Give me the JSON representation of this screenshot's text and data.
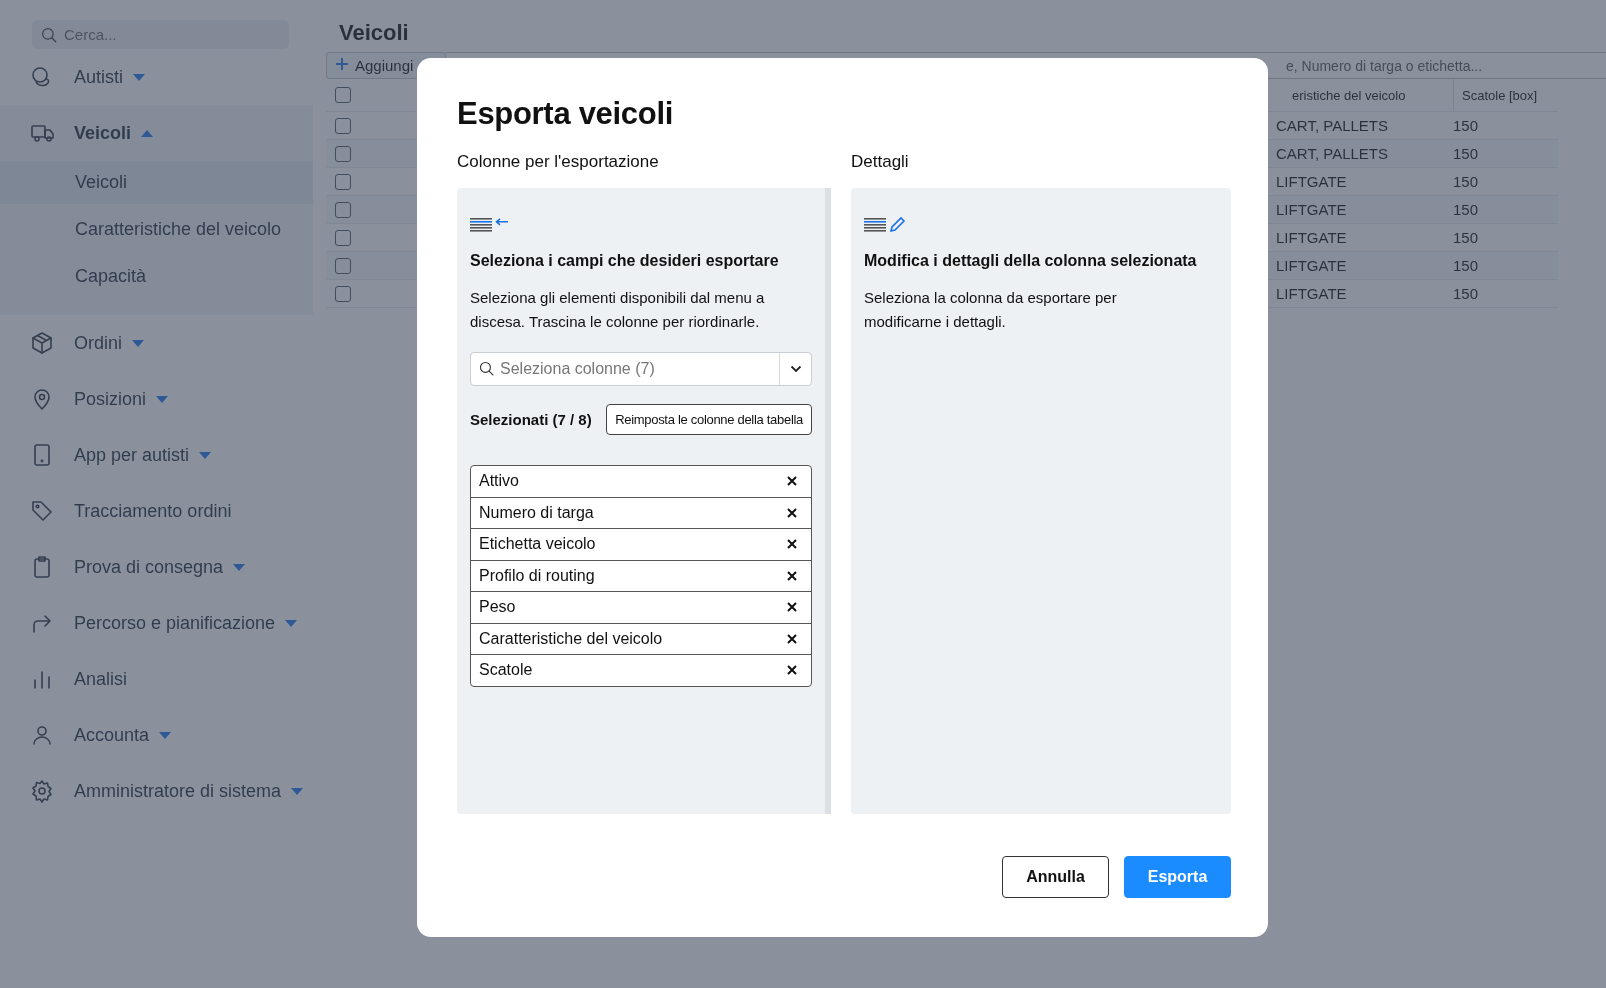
{
  "sidebar": {
    "search": {
      "placeholder": "Cerca..."
    },
    "items": [
      {
        "label": "Autisti",
        "expanded": false,
        "selected": false
      },
      {
        "label": "Veicoli",
        "expanded": true,
        "selected": true,
        "children": [
          {
            "label": "Veicoli",
            "selected": true
          },
          {
            "label": "Caratteristiche del veicolo",
            "selected": false
          },
          {
            "label": "Capacità",
            "selected": false
          }
        ]
      },
      {
        "label": "Ordini",
        "expanded": false,
        "selected": false
      },
      {
        "label": "Posizioni",
        "expanded": false,
        "selected": false
      },
      {
        "label": "App per autisti",
        "expanded": false,
        "selected": false
      },
      {
        "label": "Tracciamento ordini",
        "selected": false
      },
      {
        "label": "Prova di consegna",
        "expanded": false,
        "selected": false
      },
      {
        "label": "Percorso e pianificazione",
        "expanded": false,
        "selected": false
      },
      {
        "label": "Analisi",
        "selected": false
      },
      {
        "label": "Accounta",
        "expanded": false,
        "selected": false
      },
      {
        "label": "Amministratore di sistema",
        "expanded": false,
        "selected": false
      }
    ]
  },
  "page": {
    "title": "Veicoli",
    "add_button": "Aggiungi",
    "search": {
      "placeholder": "e, Numero di targa o etichetta..."
    },
    "table": {
      "columns": [
        "eristiche del veicolo",
        "Scatole [box]"
      ],
      "header_checked": false,
      "rows": [
        {
          "checked": false,
          "cells": [
            "CART, PALLETS",
            "150"
          ]
        },
        {
          "checked": false,
          "cells": [
            "CART, PALLETS",
            "150"
          ]
        },
        {
          "checked": false,
          "cells": [
            "LIFTGATE",
            "150"
          ]
        },
        {
          "checked": false,
          "cells": [
            "LIFTGATE",
            "150"
          ]
        },
        {
          "checked": false,
          "cells": [
            "LIFTGATE",
            "150"
          ]
        },
        {
          "checked": false,
          "cells": [
            "LIFTGATE",
            "150"
          ]
        },
        {
          "checked": false,
          "cells": [
            "LIFTGATE",
            "150"
          ]
        }
      ]
    }
  },
  "dialog": {
    "title": "Esporta veicoli",
    "left": {
      "label": "Colonne per l'esportazione",
      "heading": "Seleziona i campi che desideri esportare",
      "text": "Seleziona gli elementi disponibili dal menu a discesa. Trascina le colonne per riordinarle.",
      "select": {
        "placeholder": "Seleziona colonne (7)"
      },
      "selected_label": "Selezionati (7 / 8)",
      "reset_button": "Reimposta le colonne della tabella",
      "columns": [
        "Attivo",
        "Numero di targa",
        "Etichetta veicolo",
        "Profilo di routing",
        "Peso",
        "Caratteristiche del veicolo",
        "Scatole"
      ]
    },
    "right": {
      "label": "Dettagli",
      "heading": "Modifica i dettagli della colonna selezionata",
      "text": "Seleziona la colonna da esportare per modificarne i dettagli."
    },
    "buttons": [
      {
        "label": "Annulla",
        "kind": "secondary"
      },
      {
        "label": "Esporta",
        "kind": "primary"
      }
    ]
  }
}
